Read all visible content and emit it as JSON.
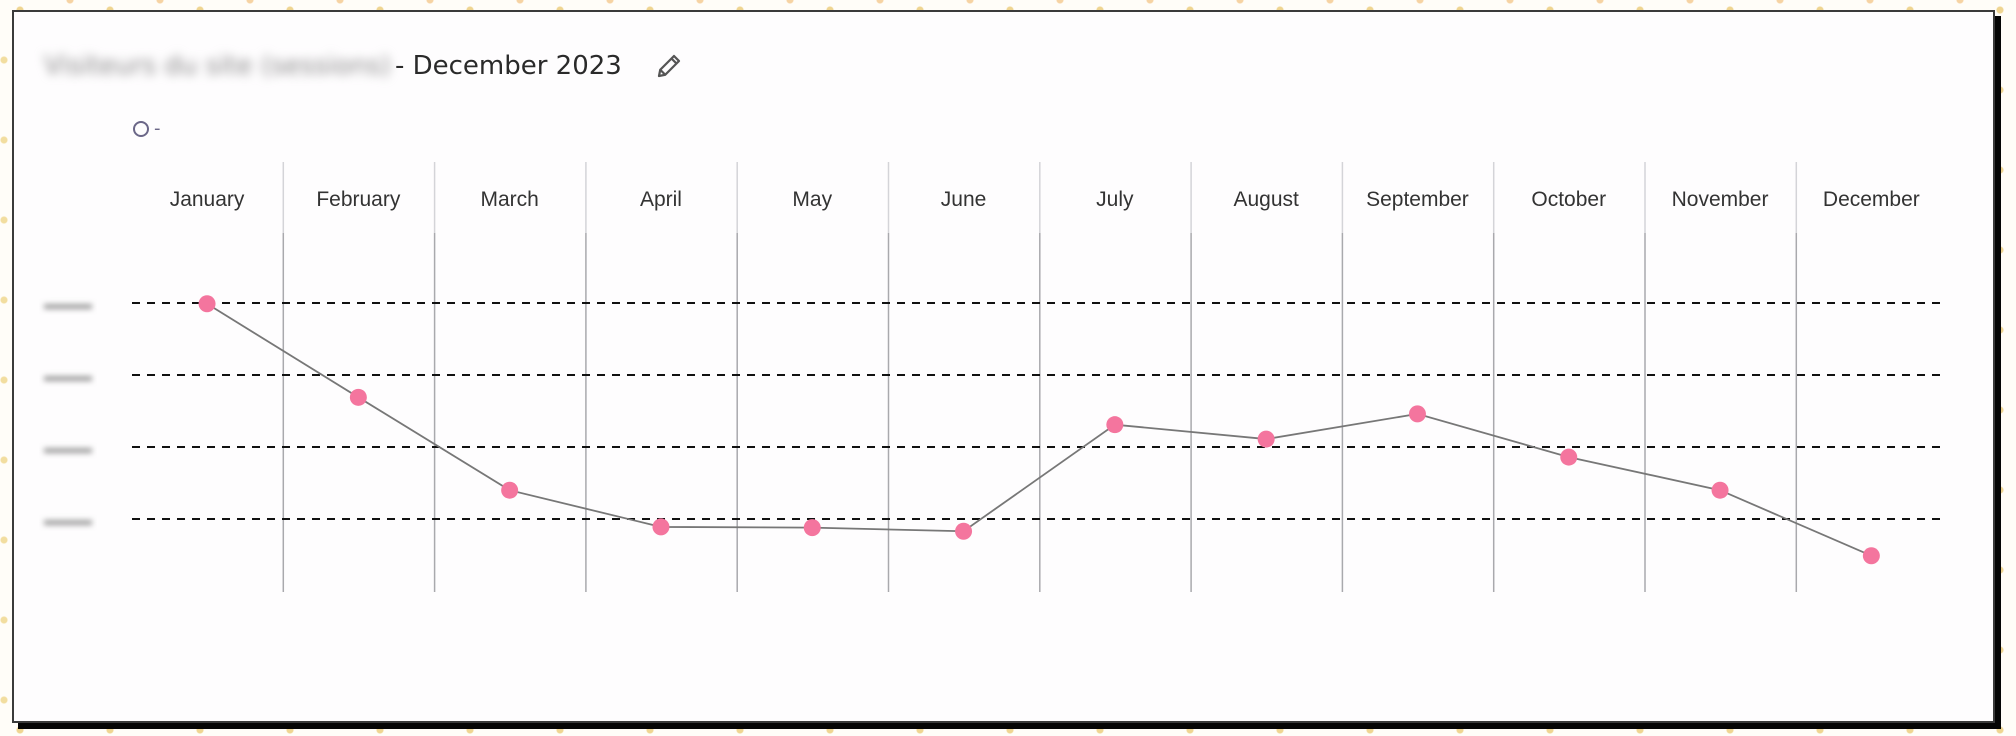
{
  "header": {
    "title_blurred": "Visiteurs du site (sessions)",
    "title_period": "- December 2023",
    "edit_icon": "pencil-icon"
  },
  "legend": {
    "items": [
      {
        "marker": "circle-outline",
        "label": "-",
        "color": "#6b6788"
      }
    ]
  },
  "colors": {
    "point": "#f4759e",
    "line": "#777777",
    "grid": "#111111",
    "divider": "#a9a9ad"
  },
  "chart_data": {
    "type": "line",
    "title": "- December 2023",
    "xlabel": "",
    "ylabel": "",
    "categories": [
      "January",
      "February",
      "March",
      "April",
      "May",
      "June",
      "July",
      "August",
      "September",
      "October",
      "November",
      "December"
    ],
    "y_tick_labels": [
      "(blurred)",
      "(blurred)",
      "(blurred)",
      "(blurred)"
    ],
    "y_ticks_note": "Y-axis tick labels are blurred/unreadable; values expressed in gridline units (bottom gridline = 1, top gridline = 4)",
    "ylim": [
      0,
      4.6
    ],
    "gridlines": [
      1,
      2,
      3,
      4
    ],
    "grid": true,
    "legend_position": "top-left",
    "series": [
      {
        "name": "-",
        "values": [
          3.99,
          2.69,
          1.4,
          0.89,
          0.88,
          0.83,
          2.31,
          2.11,
          2.46,
          1.86,
          1.4,
          0.49
        ]
      }
    ]
  }
}
